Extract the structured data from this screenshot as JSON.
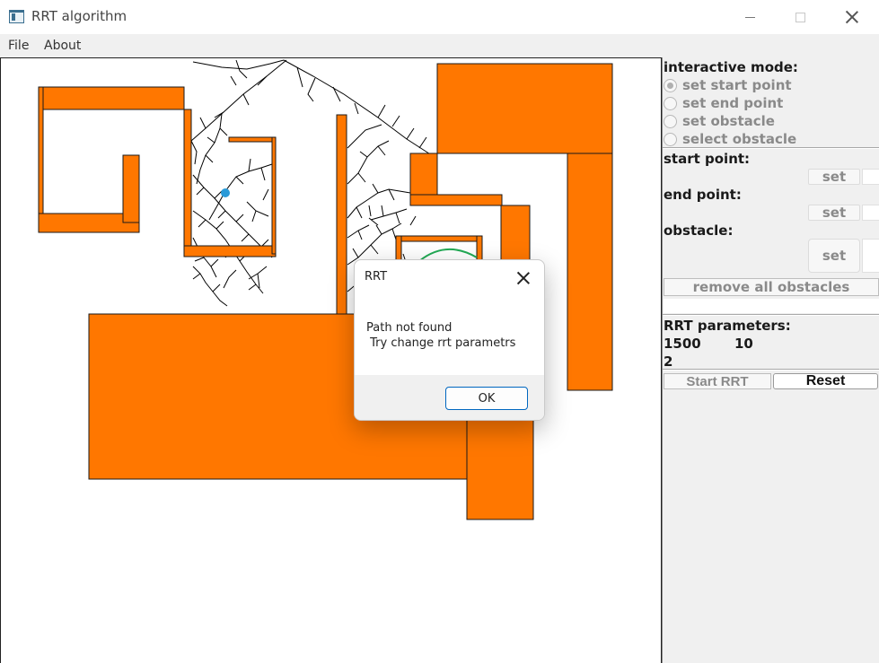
{
  "window": {
    "title": "RRT algorithm",
    "icons": [
      "app-icon",
      "minimize-icon",
      "maximize-icon",
      "close-icon"
    ]
  },
  "menu": {
    "file": "File",
    "about": "About"
  },
  "canvas": {
    "obstacle_color": "#ff7700",
    "tree_color": "#000000",
    "start_point_color": "#2a9ad8",
    "path_color": "#22aa55"
  },
  "panel": {
    "interactive_mode_label": "interactive mode:",
    "modes": [
      {
        "label": "set start point",
        "selected": true
      },
      {
        "label": "set end point",
        "selected": false
      },
      {
        "label": "set obstacle",
        "selected": false
      },
      {
        "label": "select obstacle",
        "selected": false
      }
    ],
    "start_point_label": "start point:",
    "end_point_label": "end point:",
    "obstacle_label": "obstacle:",
    "set_label": "set",
    "remove_all_label": "remove all obstacles",
    "rrt_params_label": "RRT parameters:",
    "param_iterations": "1500",
    "param_step": "10",
    "param_third": "2",
    "start_rrt_label": "Start RRT",
    "reset_label": "Reset"
  },
  "dialog": {
    "title": "RRT",
    "message_line1": "Path not found",
    "message_line2": " Try change rrt parametrs",
    "ok_label": "OK",
    "accent_color": "#0067c0"
  }
}
